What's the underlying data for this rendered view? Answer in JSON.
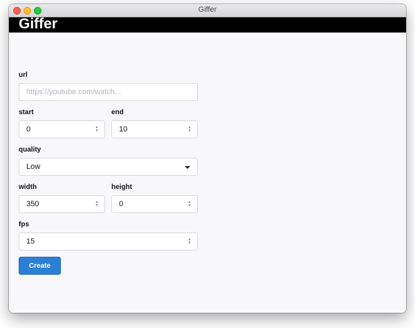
{
  "window": {
    "title": "Giffer"
  },
  "app": {
    "title": "Giffer"
  },
  "form": {
    "url": {
      "label": "url",
      "value": "",
      "placeholder": "https://youtube.com/watch..."
    },
    "start": {
      "label": "start",
      "value": "0"
    },
    "end": {
      "label": "end",
      "value": "10"
    },
    "quality": {
      "label": "quality",
      "value": "Low"
    },
    "width": {
      "label": "width",
      "value": "350"
    },
    "height": {
      "label": "height",
      "value": "0"
    },
    "fps": {
      "label": "fps",
      "value": "15"
    },
    "submit_label": "Create"
  },
  "colors": {
    "header_bg": "#000000",
    "button_bg": "#2b7fd4",
    "content_bg": "#f8f7fa"
  },
  "icons": {
    "stepper": "up-down-arrows-icon",
    "select": "caret-down-icon"
  }
}
